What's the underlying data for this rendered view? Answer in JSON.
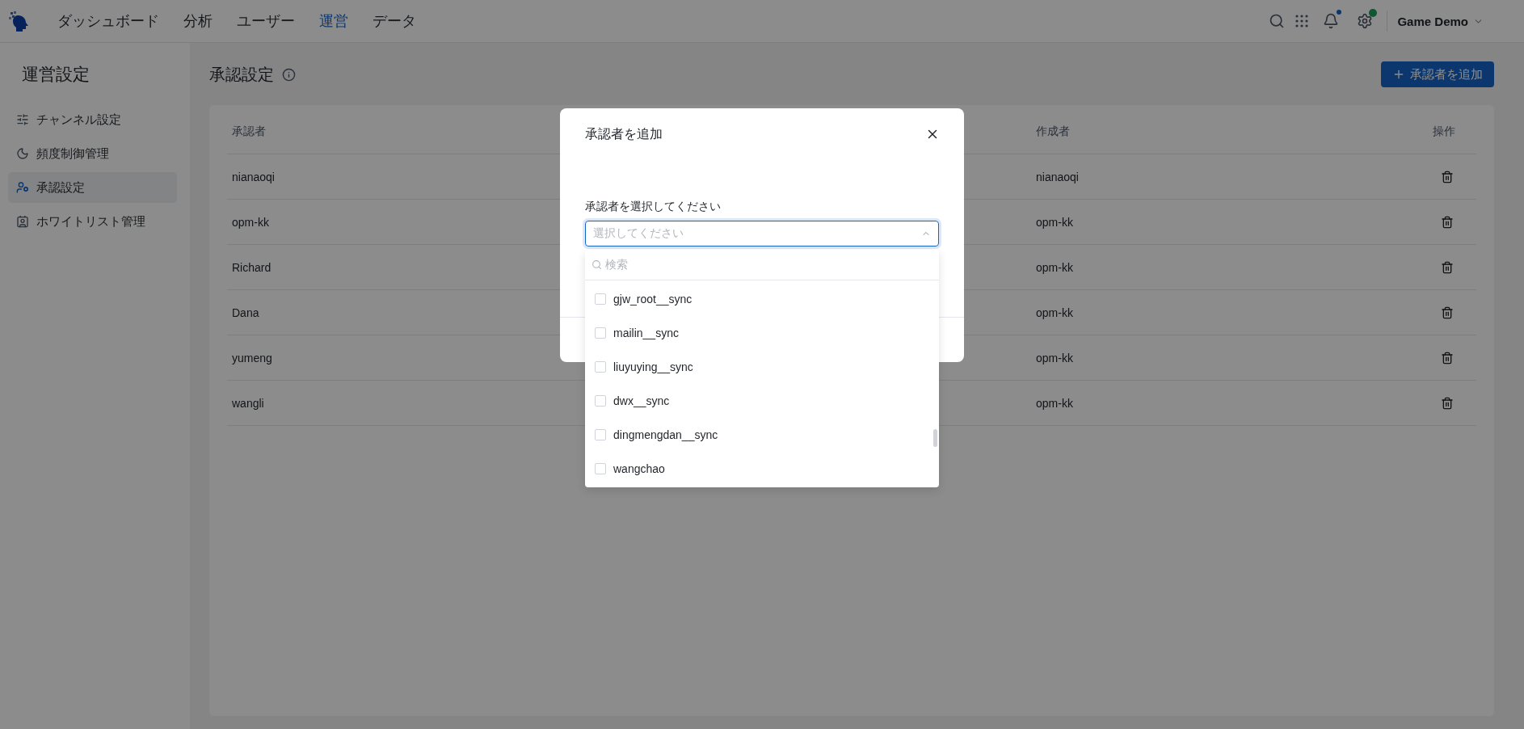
{
  "nav": {
    "items": [
      {
        "label": "ダッシュボード",
        "selected": false
      },
      {
        "label": "分析",
        "selected": false
      },
      {
        "label": "ユーザー",
        "selected": false
      },
      {
        "label": "運営",
        "selected": true
      },
      {
        "label": "データ",
        "selected": false
      }
    ],
    "notification_dot": true,
    "settings_badge": true,
    "account": "Game Demo"
  },
  "sidebar": {
    "title": "運営設定",
    "items": [
      {
        "label": "チャンネル設定",
        "kind": "sliders",
        "selected": false
      },
      {
        "label": "頻度制御管理",
        "kind": "moon",
        "selected": false
      },
      {
        "label": "承認設定",
        "kind": "user",
        "selected": true
      },
      {
        "label": "ホワイトリスト管理",
        "kind": "contact",
        "selected": false
      }
    ]
  },
  "page": {
    "title": "承認設定",
    "add_button": "承認者を追加"
  },
  "table": {
    "columns": [
      "承認者",
      "作成者",
      "操作"
    ],
    "rows": [
      {
        "approver": "nianaoqi",
        "creator": "nianaoqi"
      },
      {
        "approver": "opm-kk",
        "creator": "opm-kk"
      },
      {
        "approver": "Richard",
        "creator": "opm-kk"
      },
      {
        "approver": "Dana",
        "creator": "opm-kk"
      },
      {
        "approver": "yumeng",
        "creator": "opm-kk"
      },
      {
        "approver": "wangli",
        "creator": "opm-kk"
      }
    ]
  },
  "dialog": {
    "title": "承認者を追加",
    "field_label": "承認者を選択してください",
    "select": {
      "placeholder": "選択してください",
      "expanded": true
    },
    "dropdown": {
      "search_placeholder": "検索",
      "options": [
        {
          "label": "gjw_root__sync",
          "checked": false
        },
        {
          "label": "mailin__sync",
          "checked": false
        },
        {
          "label": "liuyuying__sync",
          "checked": false
        },
        {
          "label": "dwx__sync",
          "checked": false
        },
        {
          "label": "dingmengdan__sync",
          "checked": false
        },
        {
          "label": "wangchao",
          "checked": false
        }
      ]
    }
  }
}
